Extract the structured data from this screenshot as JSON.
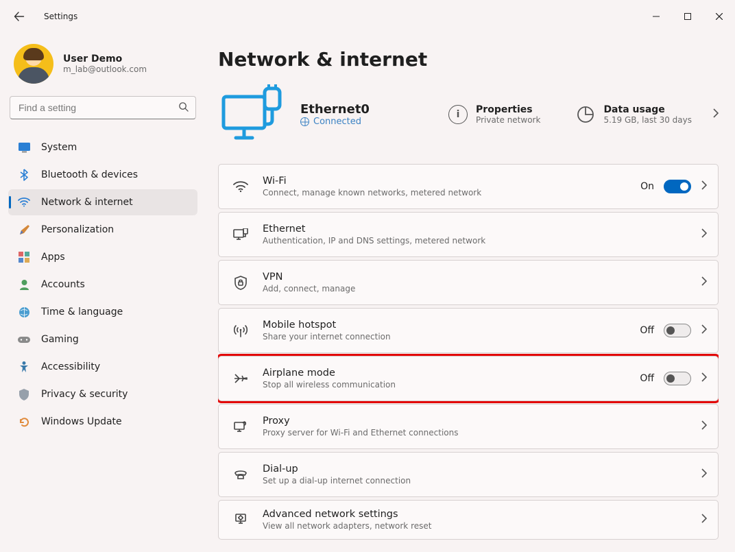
{
  "titlebar": {
    "title": "Settings"
  },
  "profile": {
    "name": "User Demo",
    "email": "m_lab@outlook.com"
  },
  "search": {
    "placeholder": "Find a setting"
  },
  "sidebar": {
    "items": [
      {
        "id": "system",
        "label": "System",
        "icon": "monitor-icon"
      },
      {
        "id": "bluetooth",
        "label": "Bluetooth & devices",
        "icon": "bluetooth-icon"
      },
      {
        "id": "network",
        "label": "Network & internet",
        "icon": "wifi-icon",
        "selected": true
      },
      {
        "id": "personalization",
        "label": "Personalization",
        "icon": "paintbrush-icon"
      },
      {
        "id": "apps",
        "label": "Apps",
        "icon": "apps-icon"
      },
      {
        "id": "accounts",
        "label": "Accounts",
        "icon": "person-icon"
      },
      {
        "id": "time",
        "label": "Time & language",
        "icon": "globe-clock-icon"
      },
      {
        "id": "gaming",
        "label": "Gaming",
        "icon": "gamepad-icon"
      },
      {
        "id": "accessibility",
        "label": "Accessibility",
        "icon": "accessibility-icon"
      },
      {
        "id": "privacy",
        "label": "Privacy & security",
        "icon": "shield-icon"
      },
      {
        "id": "update",
        "label": "Windows Update",
        "icon": "update-icon"
      }
    ]
  },
  "page": {
    "title": "Network & internet",
    "connection": {
      "name": "Ethernet0",
      "status": "Connected"
    },
    "properties": {
      "title": "Properties",
      "sub": "Private network"
    },
    "data_usage": {
      "title": "Data usage",
      "sub": "5.19 GB, last 30 days"
    },
    "cards": [
      {
        "id": "wifi",
        "title": "Wi-Fi",
        "sub": "Connect, manage known networks, metered network",
        "toggle": "On",
        "toggle_on": true
      },
      {
        "id": "ethernet",
        "title": "Ethernet",
        "sub": "Authentication, IP and DNS settings, metered network"
      },
      {
        "id": "vpn",
        "title": "VPN",
        "sub": "Add, connect, manage"
      },
      {
        "id": "hotspot",
        "title": "Mobile hotspot",
        "sub": "Share your internet connection",
        "toggle": "Off",
        "toggle_on": false
      },
      {
        "id": "airplane",
        "title": "Airplane mode",
        "sub": "Stop all wireless communication",
        "toggle": "Off",
        "toggle_on": false,
        "highlight": true
      },
      {
        "id": "proxy",
        "title": "Proxy",
        "sub": "Proxy server for Wi-Fi and Ethernet connections"
      },
      {
        "id": "dialup",
        "title": "Dial-up",
        "sub": "Set up a dial-up internet connection"
      },
      {
        "id": "advanced",
        "title": "Advanced network settings",
        "sub": "View all network adapters, network reset"
      }
    ]
  }
}
